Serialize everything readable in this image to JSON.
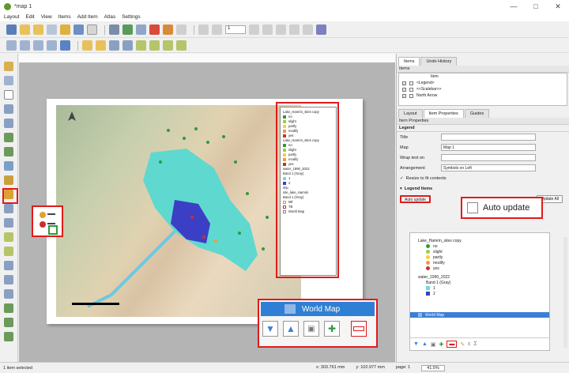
{
  "window": {
    "title": "*map 1",
    "controls": [
      "—",
      "□",
      "✕"
    ]
  },
  "menu": [
    "Layout",
    "Edit",
    "View",
    "Items",
    "Add Item",
    "Atlas",
    "Settings"
  ],
  "toolbar": {
    "page_field": "1"
  },
  "panel": {
    "top_tabs": [
      "Items",
      "Undo History"
    ],
    "items_header": "Items",
    "items_col": "Item",
    "items": [
      "<Legend>",
      "<<Scalebar>>",
      "North Arrow"
    ],
    "mid_tabs": [
      "Layout",
      "Item Properties",
      "Guides"
    ],
    "item_props_label": "Item Properties",
    "section": "Legend",
    "title_label": "Title",
    "map_label": "Map",
    "map_value": "Map 1",
    "wrap_label": "Wrap text on",
    "arrangement_label": "Arrangement",
    "arrangement_value": "Symbols on Left",
    "resize_label": "Resize to fit contents",
    "legend_items_label": "Legend Items",
    "auto_update_btn": "Auto update",
    "update_all_btn": "Update All"
  },
  "callouts": {
    "auto_update": "Auto update",
    "world_map": "World Map"
  },
  "tree": [
    {
      "label": "Lake_Hamrin_sites copy",
      "kind": "group"
    },
    {
      "label": "no",
      "color": "#2e9b3a"
    },
    {
      "label": "slight",
      "color": "#a3cc3a"
    },
    {
      "label": "partly",
      "color": "#f2d33a"
    },
    {
      "label": "modify",
      "color": "#f29a3a"
    },
    {
      "label": "yes",
      "color": "#c8302e"
    },
    {
      "label": "water_1990_2022",
      "kind": "group"
    },
    {
      "label": "Band 1 (Gray)",
      "kind": "sub"
    },
    {
      "label": "1",
      "sq": "#66e0d8"
    },
    {
      "label": "2",
      "sq": "#3b3fc6"
    },
    {
      "label": "World Map",
      "kind": "selected"
    }
  ],
  "map_legend": {
    "lines": [
      "Lake_Hamrin_sites copy",
      "no",
      "slight",
      "partly",
      "modify",
      "yes",
      "Lake_Hamrin_sites copy",
      "no",
      "slight",
      "partly",
      "modify",
      "yes",
      "water_1990_2022",
      "Band 1 (Gray)",
      "1",
      "2",
      "shp",
      "site_lake_Hamrin",
      "Band 1 (Gray)",
      "Mil",
      "TB",
      "World Map"
    ]
  },
  "status": {
    "left": "1 item selected",
    "x": "x: 303.761 mm",
    "y": "y: 102.977 mm",
    "page": "page: 1",
    "zoom": "41.5%"
  },
  "colors": {
    "accent_red": "#e01b1b",
    "lake_teal": "#5fd8d0",
    "lake_blue": "#3b3fc6",
    "selection_blue": "#3b7fd4"
  }
}
